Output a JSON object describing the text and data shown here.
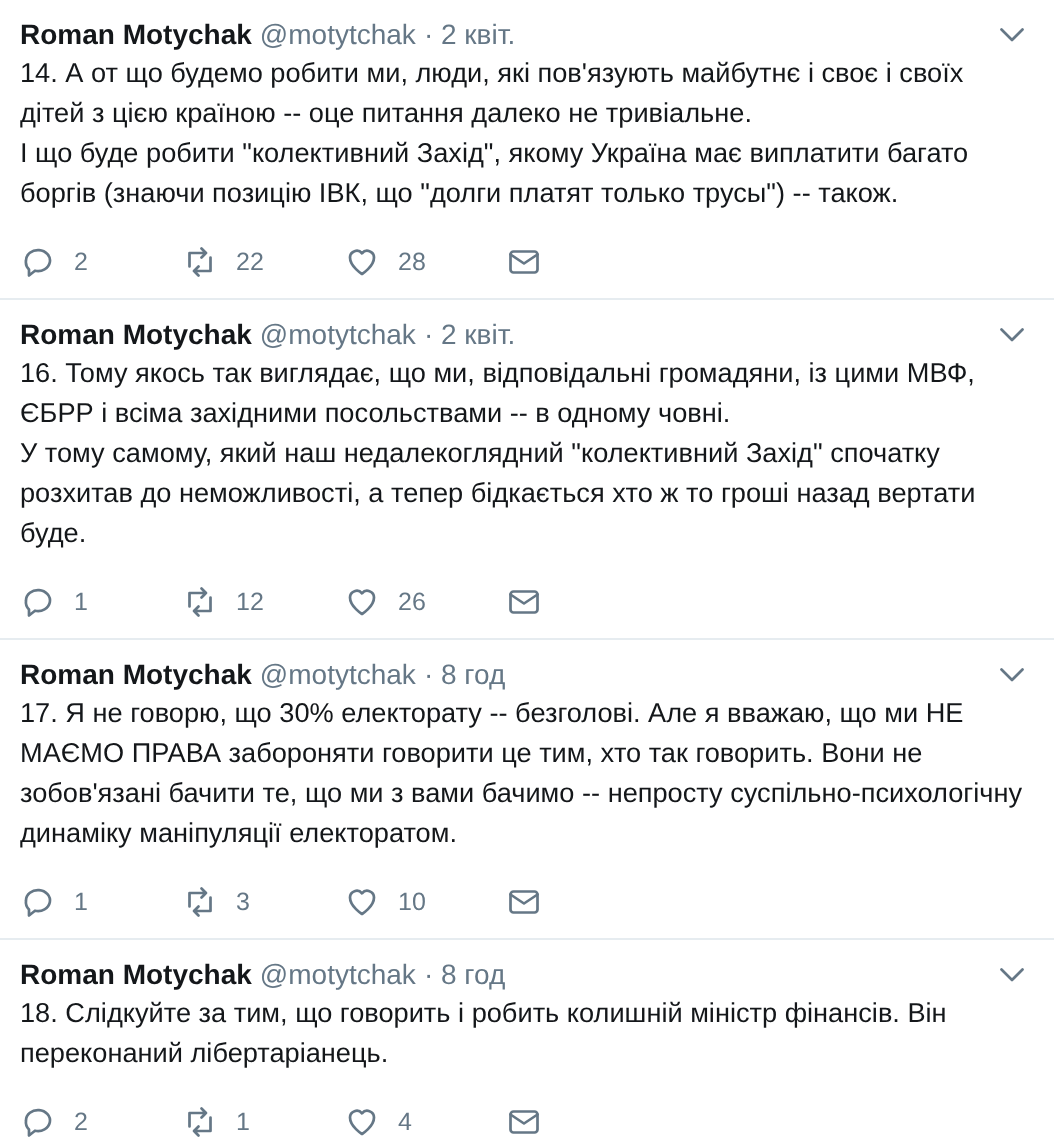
{
  "tweets": [
    {
      "name": "Roman Motychak",
      "handle": "@motytchak",
      "time": "· 2 квіт.",
      "paragraphs": [
        "14. А от що будемо робити ми, люди, які пов'язують майбутнє і своє і своїх дітей з цією країною -- оце питання далеко не тривіальне.",
        "І що буде робити \"колективний Захід\", якому Україна має виплатити багато боргів (знаючи позицію ІВК, що \"долги платят только трусы\") -- також."
      ],
      "replies": "2",
      "retweets": "22",
      "likes": "28"
    },
    {
      "name": "Roman Motychak",
      "handle": "@motytchak",
      "time": "· 2 квіт.",
      "paragraphs": [
        "16. Тому якось так виглядає, що ми, відповідальні громадяни, із цими МВФ, ЄБРР і всіма західними посольствами -- в одному човні.",
        "У тому самому, який наш недалекоглядний \"колективний Захід\" спочатку розхитав до неможливості, а тепер бідкається хто ж то гроші назад вертати буде."
      ],
      "replies": "1",
      "retweets": "12",
      "likes": "26"
    },
    {
      "name": "Roman Motychak",
      "handle": "@motytchak",
      "time": "· 8 год",
      "paragraphs": [
        "17. Я не говорю, що 30% електорату -- безголові. Але я вважаю, що ми НЕ МАЄМО ПРАВА забороняти говорити це тим, хто так говорить. Вони не зобов'язані бачити те, що ми з вами бачимо -- непросту суспільно-психологічну динаміку маніпуляції електоратом."
      ],
      "replies": "1",
      "retweets": "3",
      "likes": "10"
    },
    {
      "name": "Roman Motychak",
      "handle": "@motytchak",
      "time": "· 8 год",
      "paragraphs": [
        "18. Слідкуйте за тим, що говорить і робить колишній міністр фінансів. Він переконаний лібертаріанець."
      ],
      "replies": "2",
      "retweets": "1",
      "likes": "4"
    }
  ]
}
